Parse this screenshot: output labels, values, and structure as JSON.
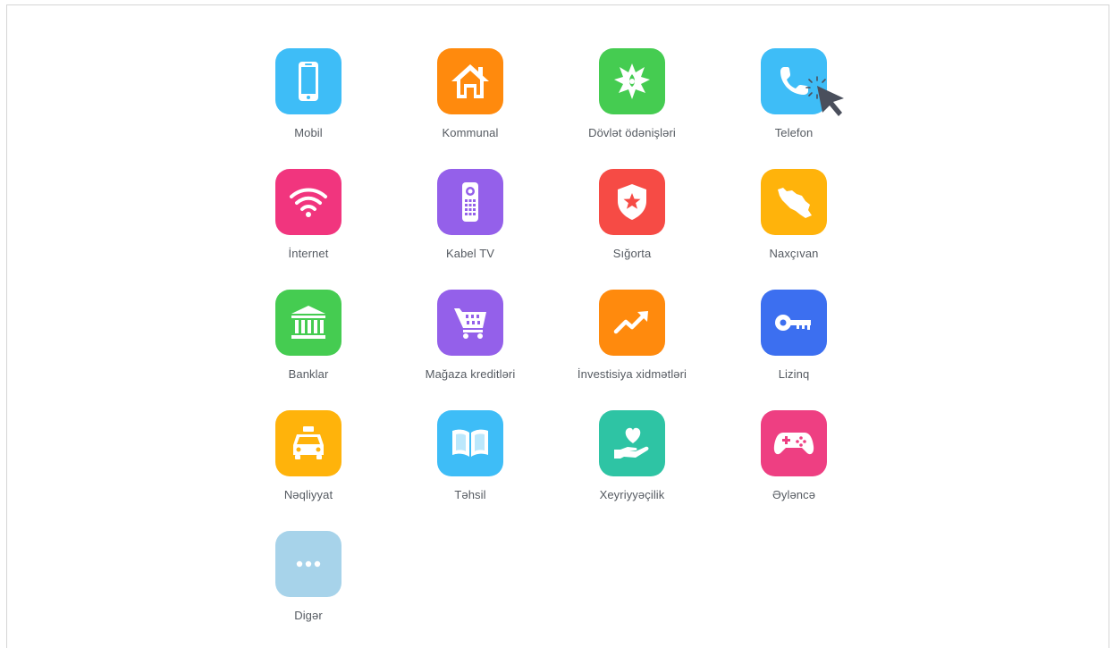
{
  "services": [
    {
      "label": "Mobil",
      "icon": "mobile-phone-icon",
      "color": "#3ebdf7"
    },
    {
      "label": "Kommunal",
      "icon": "house-icon",
      "color": "#ff8a0d"
    },
    {
      "label": "Dövlət ödənişləri",
      "icon": "emblem-icon",
      "color": "#45cc51"
    },
    {
      "label": "Telefon",
      "icon": "telephone-icon",
      "color": "#3ebdf7"
    },
    {
      "label": "İnternet",
      "icon": "wifi-icon",
      "color": "#f1357e"
    },
    {
      "label": "Kabel TV",
      "icon": "remote-control-icon",
      "color": "#9460ea"
    },
    {
      "label": "Sığorta",
      "icon": "shield-star-icon",
      "color": "#f64b45"
    },
    {
      "label": "Naxçıvan",
      "icon": "nakhchivan-map-icon",
      "color": "#ffb30b"
    },
    {
      "label": "Banklar",
      "icon": "bank-icon",
      "color": "#45cc51"
    },
    {
      "label": "Mağaza kreditləri",
      "icon": "shopping-cart-icon",
      "color": "#9460ea"
    },
    {
      "label": "İnvestisiya xidmətləri",
      "icon": "trending-up-icon",
      "color": "#ff8a0d"
    },
    {
      "label": "Lizinq",
      "icon": "key-icon",
      "color": "#3c6ff0"
    },
    {
      "label": "Nəqliyyat",
      "icon": "taxi-icon",
      "color": "#ffb30b"
    },
    {
      "label": "Təhsil",
      "icon": "open-book-icon",
      "color": "#3ebdf7"
    },
    {
      "label": "Xeyriyyəçilik",
      "icon": "heart-hand-icon",
      "color": "#2ec4a4"
    },
    {
      "label": "Əyləncə",
      "icon": "gamepad-icon",
      "color": "#ee3f82"
    },
    {
      "label": "Digər",
      "icon": "more-dots-icon",
      "color": "#a7d3ea"
    }
  ]
}
